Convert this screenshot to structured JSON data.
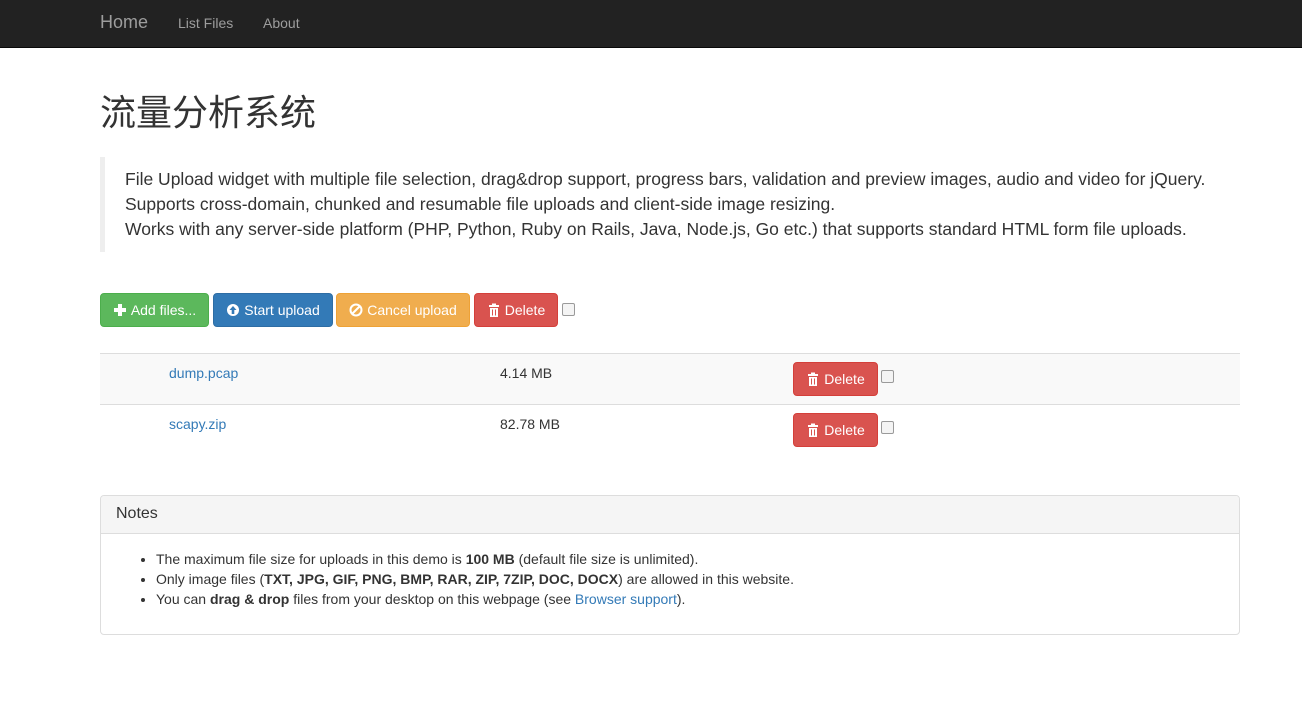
{
  "nav": {
    "brand": "Home",
    "links": [
      "List Files",
      "About"
    ]
  },
  "page": {
    "title": "流量分析系统",
    "description": [
      "File Upload widget with multiple file selection, drag&drop support, progress bars, validation and preview images, audio and video for jQuery.",
      "Supports cross-domain, chunked and resumable file uploads and client-side image resizing.",
      "Works with any server-side platform (PHP, Python, Ruby on Rails, Java, Node.js, Go etc.) that supports standard HTML form file uploads."
    ]
  },
  "toolbar": {
    "add_label": "Add files...",
    "start_label": "Start upload",
    "cancel_label": "Cancel upload",
    "delete_label": "Delete",
    "select_all_checked": false
  },
  "files": [
    {
      "name": "dump.pcap",
      "size": "4.14 MB",
      "delete_label": "Delete",
      "checked": false
    },
    {
      "name": "scapy.zip",
      "size": "82.78 MB",
      "delete_label": "Delete",
      "checked": false
    }
  ],
  "notes": {
    "heading": "Notes",
    "item1": {
      "pre": "The maximum file size for uploads in this demo is ",
      "bold": "100 MB",
      "post": " (default file size is unlimited)."
    },
    "item2": {
      "pre": "Only image files (",
      "bold": "TXT, JPG, GIF, PNG, BMP, RAR, ZIP, 7ZIP, DOC, DOCX",
      "post": ") are allowed in this website."
    },
    "item3": {
      "pre": "You can ",
      "bold": "drag & drop",
      "mid": " files from your desktop on this webpage (see ",
      "link": "Browser support",
      "post": ")."
    }
  },
  "colors": {
    "navbar": "#222222",
    "success": "#5cb85c",
    "primary": "#337ab7",
    "warning": "#f0ad4e",
    "danger": "#d9534f"
  },
  "icons": {
    "add": "plus-icon",
    "start": "upload-circle-icon",
    "cancel": "ban-circle-icon",
    "delete": "trash-icon"
  }
}
